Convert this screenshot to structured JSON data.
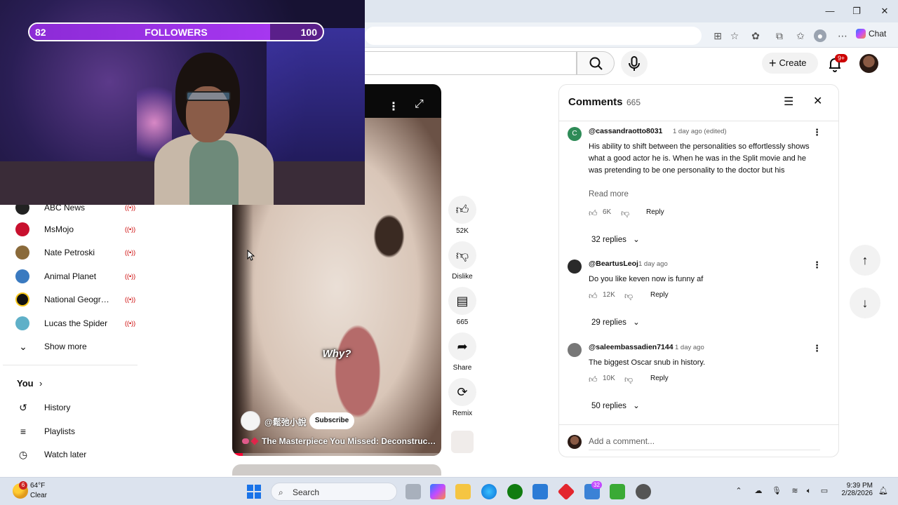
{
  "stream_overlay": {
    "followers_label": "FOLLOWERS",
    "followers_current": "82",
    "followers_goal": "100",
    "progress_fraction": 0.82
  },
  "browser": {
    "chat_label": "Chat"
  },
  "header": {
    "create_label": "Create",
    "notification_badge": "9+"
  },
  "sidebar": {
    "subscriptions": [
      {
        "name": "ABC News",
        "live_icon": "live-broadcast-icon",
        "color": "#222222"
      },
      {
        "name": "MsMojo",
        "live_icon": "live-broadcast-icon",
        "color": "#c8102e"
      },
      {
        "name": "Nate Petroski",
        "live_icon": "live-broadcast-icon",
        "color": "#8a6a3a"
      },
      {
        "name": "Animal Planet",
        "live_icon": "live-broadcast-icon",
        "color": "#3a7ac0"
      },
      {
        "name": "National Geogra...",
        "live_icon": "live-broadcast-icon",
        "color": "#111111"
      },
      {
        "name": "Lucas the Spider",
        "live_icon": "live-broadcast-icon",
        "color": "#5fb0c8"
      }
    ],
    "show_more": "Show more",
    "you_label": "You",
    "nav": [
      {
        "label": "History",
        "icon": "history-icon"
      },
      {
        "label": "Playlists",
        "icon": "playlists-icon"
      },
      {
        "label": "Watch later",
        "icon": "watch-later-icon"
      }
    ]
  },
  "short": {
    "subtitle": "Why?",
    "channel": "@鬆弛小說",
    "subscribe_label": "Subscribe",
    "title": "The Masterpiece You Missed: Deconstructing...",
    "progress_fraction": 0.05
  },
  "actions": {
    "likes": "52K",
    "dislike_label": "Dislike",
    "comments": "665",
    "share_label": "Share",
    "remix_label": "Remix"
  },
  "comments_panel": {
    "title": "Comments",
    "count": "665",
    "input_placeholder": "Add a comment...",
    "comments": [
      {
        "author": "@cassandraotto8031",
        "time": "1 day ago (edited)",
        "avatar_letter": "C",
        "avatar_color": "#2e8b57",
        "text": "His ability to shift between the personalities so effortlessly shows what a good actor he is. When he was in the Split movie and he was pretending to be one personality to the doctor but his movements were another personality . How he has never ...",
        "read_more": "Read more",
        "likes": "6K",
        "reply_label": "Reply",
        "replies": "32 replies"
      },
      {
        "author": "@BeartusLeoj",
        "time": "1 day ago",
        "avatar_letter": "",
        "avatar_color": "#2a2a2a",
        "text": "Do you like keven now is funny af",
        "likes": "12K",
        "reply_label": "Reply",
        "replies": "29 replies"
      },
      {
        "author": "@saleembassadien7144",
        "time": "1 day ago",
        "avatar_letter": "",
        "avatar_color": "#777777",
        "text": "The biggest Oscar snub in history.",
        "likes": "10K",
        "reply_label": "Reply",
        "replies": "50 replies"
      }
    ]
  },
  "taskbar": {
    "weather_temp": "64°F",
    "weather_cond": "Clear",
    "weather_badge": "6",
    "search_label": "Search",
    "teams_badge": "32",
    "time": "9:39 PM",
    "date": "2/28/2026"
  }
}
